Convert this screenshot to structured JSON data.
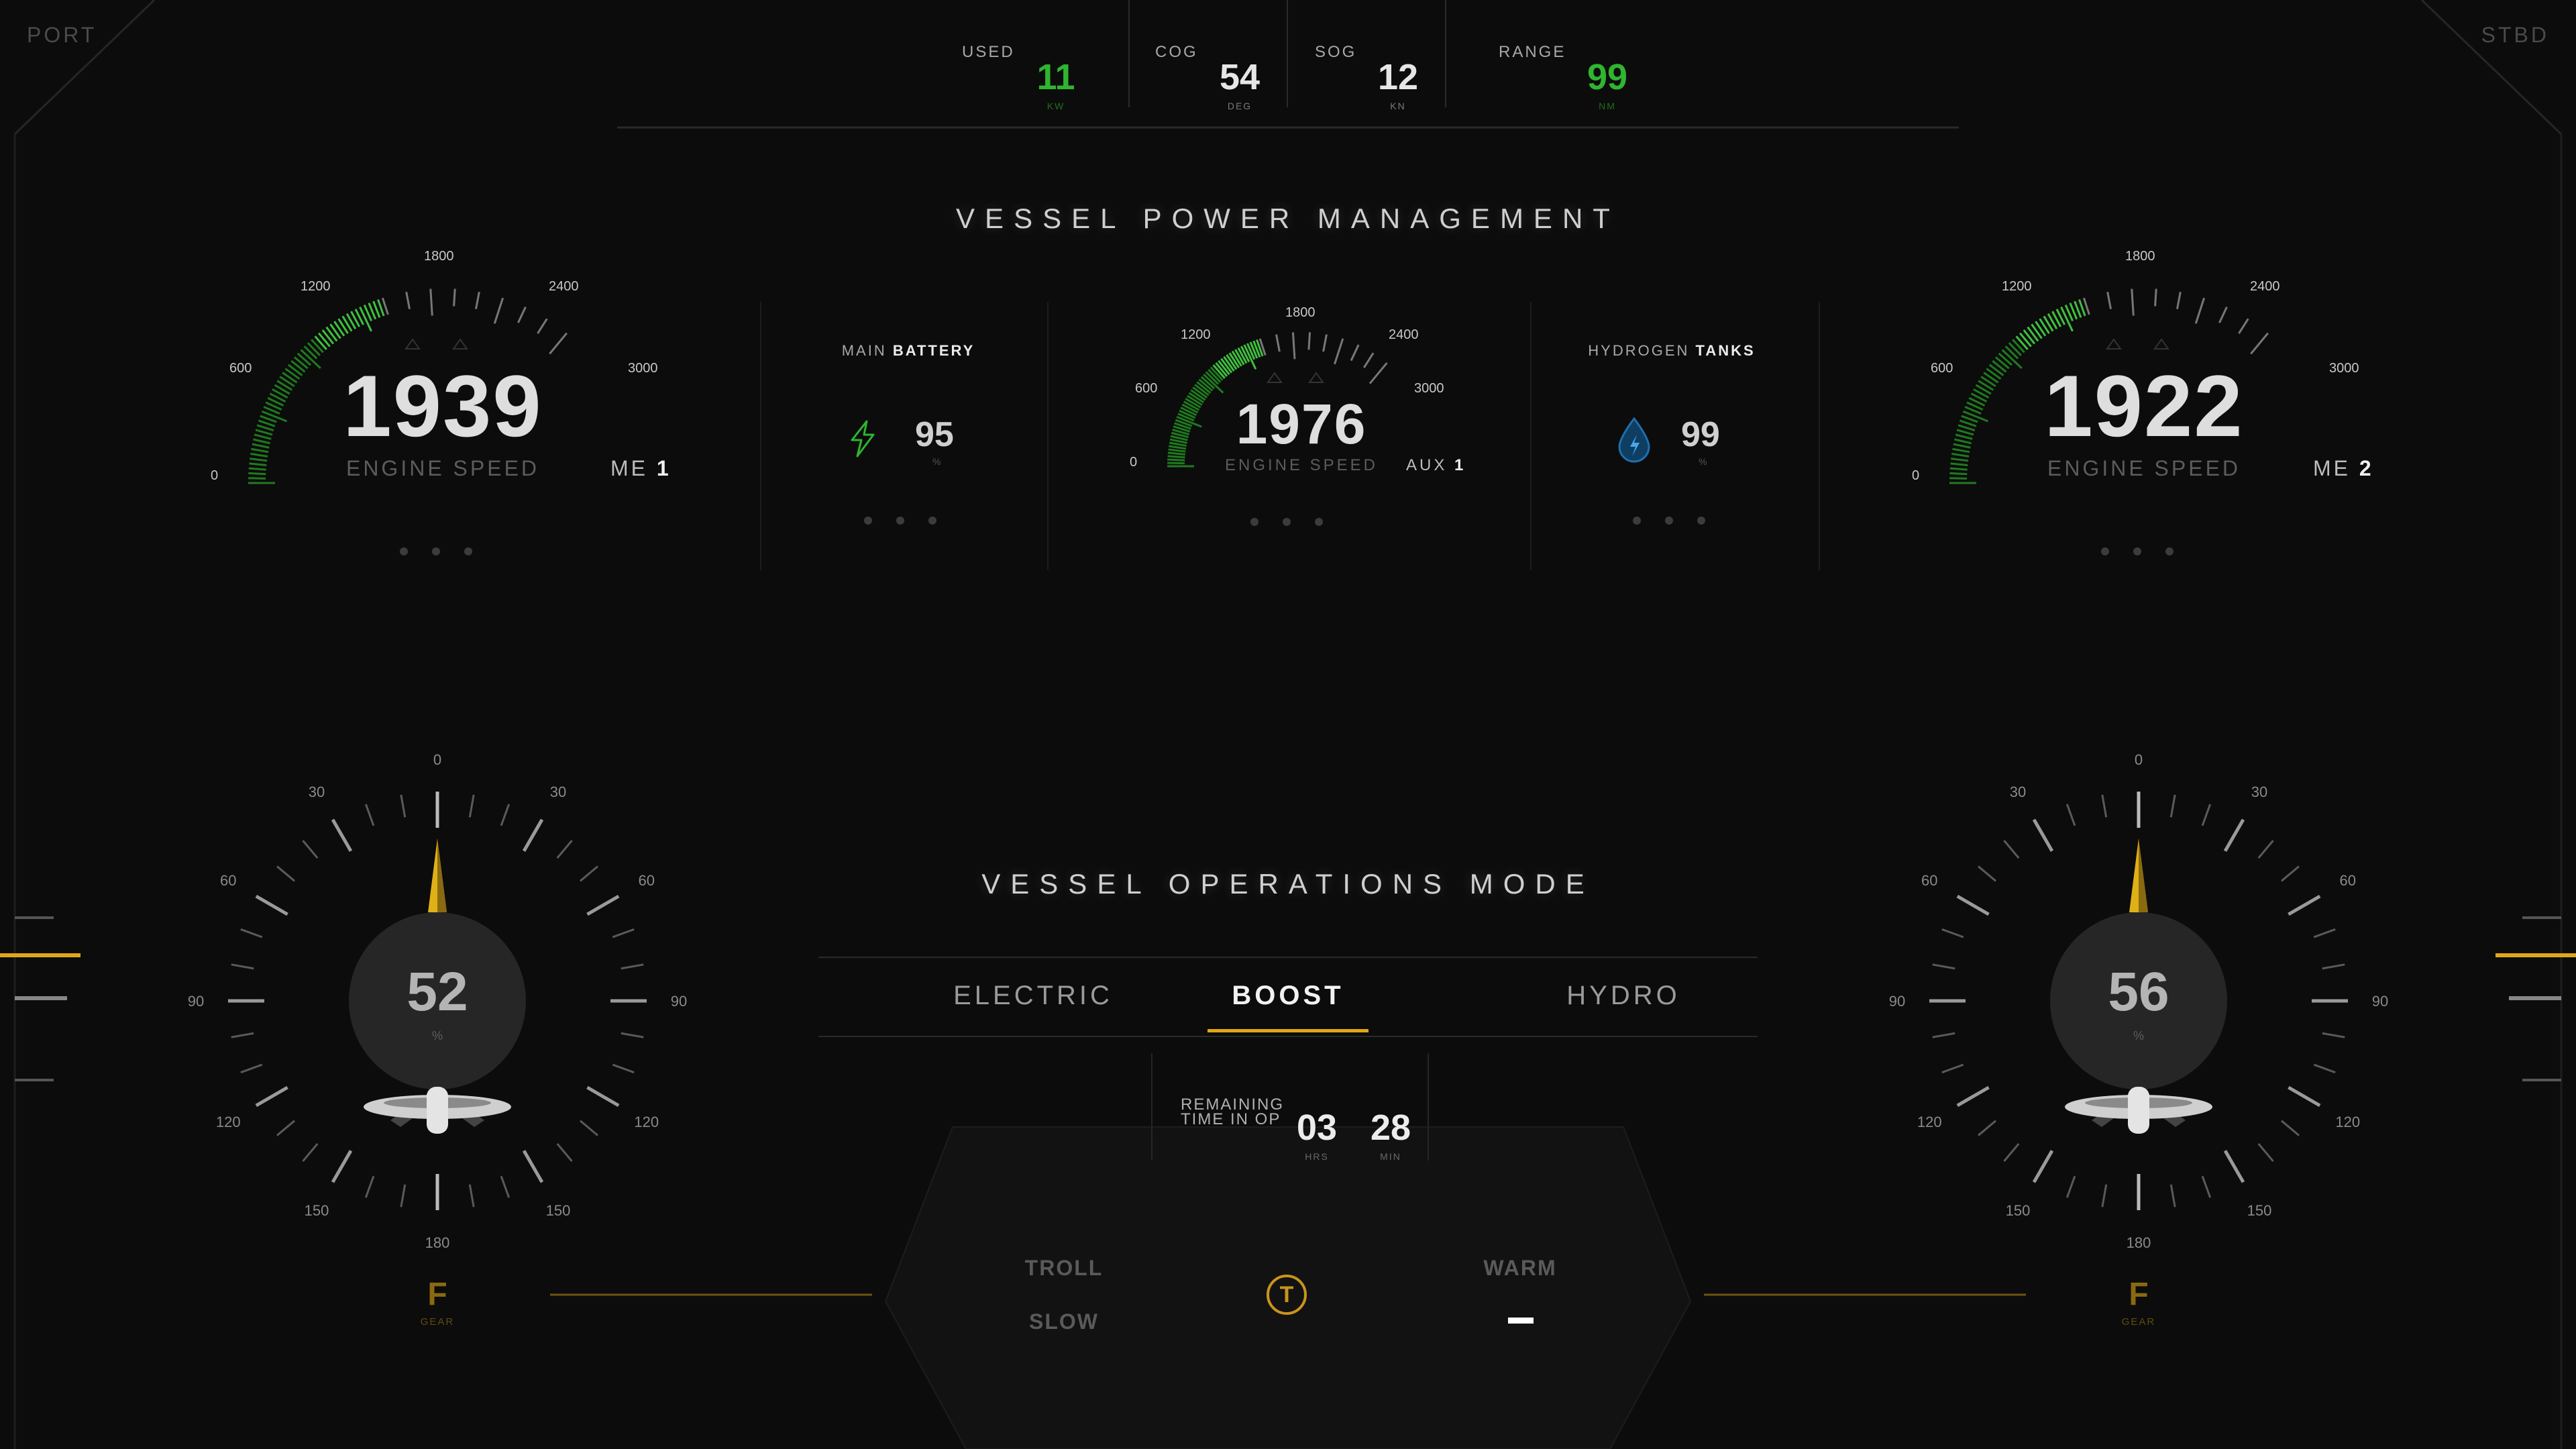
{
  "corners": {
    "port": "PORT",
    "stbd": "STBD"
  },
  "top_stats": [
    {
      "label": "USED",
      "value": "11",
      "unit": "KW",
      "color": "#2fb52f"
    },
    {
      "label": "COG",
      "value": "54",
      "unit": "DEG",
      "color": "#e6e6e6"
    },
    {
      "label": "SOG",
      "value": "12",
      "unit": "KN",
      "color": "#e6e6e6"
    },
    {
      "label": "RANGE",
      "value": "99",
      "unit": "NM",
      "color": "#2fb52f"
    }
  ],
  "power": {
    "title": "VESSEL POWER MANAGEMENT",
    "me1": {
      "value": "1939",
      "label": "ENGINE SPEED",
      "tag": "ME",
      "num": "1",
      "ticks": [
        "0",
        "600",
        "1200",
        "1800",
        "2400",
        "3000"
      ]
    },
    "battery": {
      "label_light": "MAIN",
      "label_bold": "BATTERY",
      "value": "95",
      "unit": "%",
      "icon": "lightning-bolt-icon"
    },
    "aux1": {
      "value": "1976",
      "label": "ENGINE SPEED",
      "tag": "AUX",
      "num": "1",
      "ticks": [
        "0",
        "600",
        "1200",
        "1800",
        "2400",
        "3000"
      ]
    },
    "hydrogen": {
      "label_light": "HYDROGEN",
      "label_bold": "TANKS",
      "value": "99",
      "unit": "%",
      "icon": "water-drop-icon"
    },
    "me2": {
      "value": "1922",
      "label": "ENGINE SPEED",
      "tag": "ME",
      "num": "2",
      "ticks": [
        "0",
        "600",
        "1200",
        "1800",
        "2400",
        "3000"
      ]
    }
  },
  "operations": {
    "title": "VESSEL OPERATIONS MODE",
    "tabs": [
      "ELECTRIC",
      "BOOST",
      "HYDRO"
    ],
    "active_tab": "BOOST",
    "remaining": {
      "label_line1": "REMAINING",
      "label_line2": "TIME IN OP",
      "hrs": "03",
      "hrs_unit": "HRS",
      "min": "28",
      "min_unit": "MIN"
    },
    "troll": "TROLL",
    "slow": "SLOW",
    "t_button": "T",
    "warm": "WARM"
  },
  "thrusters": {
    "dial_labels": [
      "0",
      "30",
      "60",
      "90",
      "120",
      "150",
      "180",
      "150",
      "120",
      "90",
      "60",
      "30"
    ],
    "port": {
      "value": "52",
      "unit": "%",
      "gear": "F",
      "gear_unit": "GEAR"
    },
    "stbd": {
      "value": "56",
      "unit": "%",
      "gear": "F",
      "gear_unit": "GEAR"
    }
  },
  "colors": {
    "accent": "#e0a816",
    "green": "#2fb52f",
    "hydro_blue": "#1f6fae"
  }
}
